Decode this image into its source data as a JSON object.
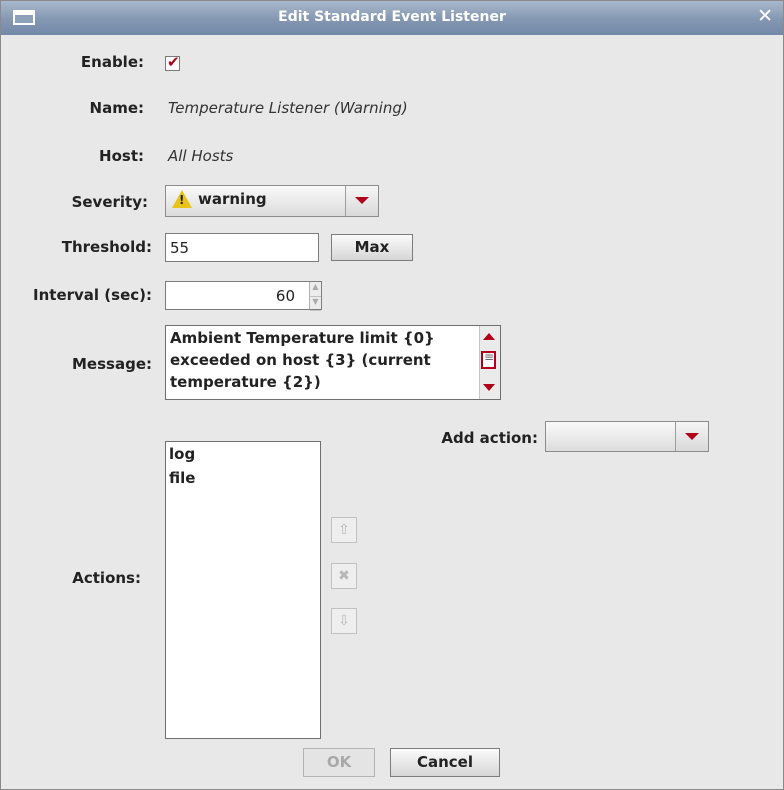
{
  "window": {
    "title": "Edit Standard Event Listener"
  },
  "enable": {
    "label": "Enable:",
    "checked": true
  },
  "name": {
    "label": "Name:",
    "value": "Temperature Listener (Warning)"
  },
  "host": {
    "label": "Host:",
    "value": "All Hosts"
  },
  "severity": {
    "label": "Severity:",
    "value": "warning",
    "icon": "warning-icon"
  },
  "threshold": {
    "label": "Threshold:",
    "value": "55",
    "max_button": "Max"
  },
  "interval": {
    "label": "Interval (sec):",
    "value": "60"
  },
  "message": {
    "label": "Message:",
    "lines": [
      "Ambient Temperature limit {0}",
      "exceeded on host {3} (current",
      "temperature {2})"
    ]
  },
  "add_action": {
    "label": "Add action:",
    "value": ""
  },
  "actions": {
    "label": "Actions:",
    "items": [
      "log",
      "file"
    ]
  },
  "buttons": {
    "ok": "OK",
    "cancel": "Cancel"
  }
}
